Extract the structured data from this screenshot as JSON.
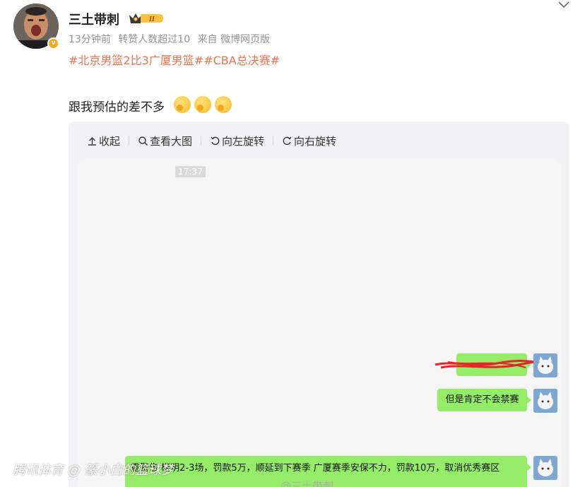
{
  "post": {
    "username": "三土带刺",
    "vip_level": "II",
    "avatar_badge": "v",
    "meta": {
      "time": "13分钟前",
      "reposts": "转赞人数超过10",
      "source": "来自 微博网页版"
    },
    "hashtags": [
      "#北京男篮2比3广厦男篮#",
      "#CBA总决赛#"
    ],
    "text": "跟我预估的差不多",
    "emojis": [
      "thinking-emoji",
      "thinking-emoji",
      "thinking-emoji"
    ]
  },
  "toolbar": {
    "collapse": "收起",
    "view_large": "查看大图",
    "rotate_left": "向左旋转",
    "rotate_right": "向右旋转"
  },
  "chat": {
    "timestamp": "17:37",
    "messages": [
      {
        "text": "",
        "redacted": true
      },
      {
        "text": "但是肯定不会禁赛"
      },
      {
        "text": "重警告 楼明2-3场，罚款5万，顺延到下赛季 广厦赛季安保不力，罚款10万，取消优秀赛区"
      }
    ]
  },
  "watermarks": {
    "left": "腾讯体育 @ 篆小白的篮球梦",
    "weibo": "@三土带刺"
  },
  "colors": {
    "accent": "#eb7350",
    "bubble": "#95ec69",
    "redaction": "#e8232a"
  }
}
